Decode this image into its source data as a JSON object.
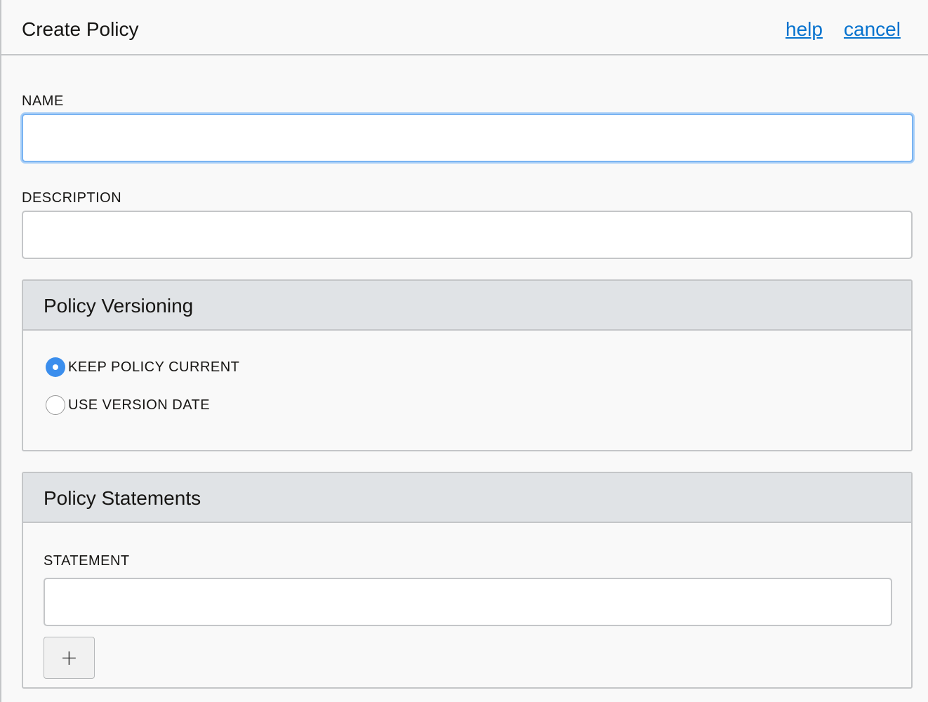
{
  "header": {
    "title": "Create Policy",
    "help_link": "help",
    "cancel_link": "cancel"
  },
  "form": {
    "name": {
      "label": "NAME",
      "value": "",
      "focused": true
    },
    "description": {
      "label": "DESCRIPTION",
      "value": ""
    }
  },
  "versioning": {
    "title": "Policy Versioning",
    "options": [
      {
        "label": "KEEP POLICY CURRENT",
        "selected": true
      },
      {
        "label": "USE VERSION DATE",
        "selected": false
      }
    ]
  },
  "statements": {
    "title": "Policy Statements",
    "statement_label": "STATEMENT",
    "statement_value": "",
    "add_button": "+"
  },
  "colors": {
    "link": "#0572ce",
    "radio_selected": "#3b8eed",
    "focus_ring": "#7ab4f2",
    "panel_header_bg": "#e0e3e6"
  }
}
